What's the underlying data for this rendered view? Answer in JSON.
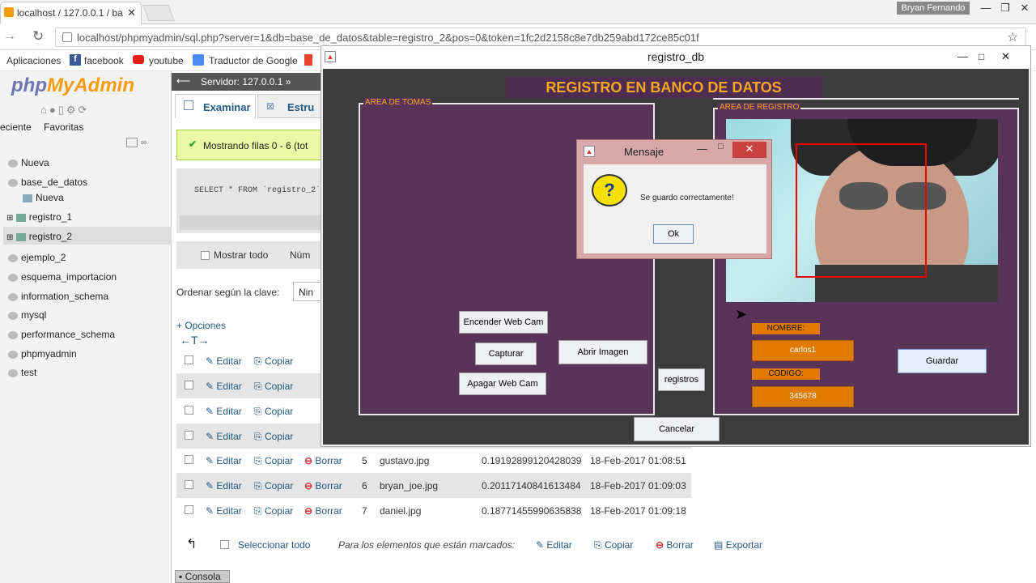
{
  "browser": {
    "tab_title": "localhost / 127.0.0.1 / ba",
    "url": "localhost/phpmyadmin/sql.php?server=1&db=base_de_datos&table=registro_2&pos=0&token=1fc2d2158c8e7db259abd172ce85c01f",
    "user": "Bryan Fernando",
    "bookmarks": [
      "Aplicaciones",
      "facebook",
      "youtube",
      "Traductor de Google"
    ]
  },
  "pma": {
    "logo_php": "php",
    "logo_admin": "MyAdmin",
    "tabs_recent": "eciente",
    "tabs_fav": "Favoritas",
    "server_crumb": "Servidor: 127.0.0.1 »",
    "tab_browse": "Examinar",
    "tab_structure": "Estru",
    "success": "Mostrando filas 0 - 6 (tot",
    "sql": "SELECT * FROM `registro_2`",
    "show_all": "Mostrar todo",
    "num": "Núm",
    "order_label": "Ordenar según la clave:",
    "order_value": "Nin",
    "options": "+ Opciones",
    "tree": [
      {
        "label": "Nueva"
      },
      {
        "label": "base_de_datos"
      },
      {
        "label": "Nueva"
      },
      {
        "label": "registro_1"
      },
      {
        "label": "registro_2"
      },
      {
        "label": "ejemplo_2"
      },
      {
        "label": "esquema_importacion"
      },
      {
        "label": "information_schema"
      },
      {
        "label": "mysql"
      },
      {
        "label": "performance_schema"
      },
      {
        "label": "phpmyadmin"
      },
      {
        "label": "test"
      }
    ],
    "actions": {
      "edit": "Editar",
      "copy": "Copiar",
      "delete": "Borrar"
    },
    "rows": [
      {
        "id": "5",
        "file": "gustavo.jpg",
        "value": "0.19192899120428039",
        "date": "18-Feb-2017 01:08:51"
      },
      {
        "id": "6",
        "file": "bryan_joe.jpg",
        "value": "0.20117140841613484",
        "date": "18-Feb-2017 01:09:03"
      },
      {
        "id": "7",
        "file": "daniel.jpg",
        "value": "0.18771455990635838",
        "date": "18-Feb-2017 01:09:18"
      }
    ],
    "select_all": "Seleccionar todo",
    "for_marked": "Para los elementos que están marcados:",
    "bulk_edit": "Editar",
    "bulk_copy": "Copiar",
    "bulk_delete": "Borrar",
    "bulk_export": "Exportar",
    "console": "Consola"
  },
  "app": {
    "title": "registro_db",
    "banner": "REGISTRO EN BANCO DE DATOS",
    "area_tomas": "AREA DE TOMAS",
    "area_registro": "AREA DE REGISTRO",
    "btn_encender": "Encender Web Cam",
    "btn_capturar": "Capturar",
    "btn_apagar": "Apagar Web Cam",
    "btn_abrir": "Abrir Imagen",
    "btn_registros": "registros",
    "btn_cancelar": "Cancelar",
    "btn_guardar": "Guardar",
    "nombre_label": "NOMBRE:",
    "nombre_value": "carlos1",
    "codigo_label": "CODIGO:",
    "codigo_value": "345678"
  },
  "dialog": {
    "title": "Mensaje",
    "message": "Se guardo correctamente!",
    "ok": "Ok"
  }
}
